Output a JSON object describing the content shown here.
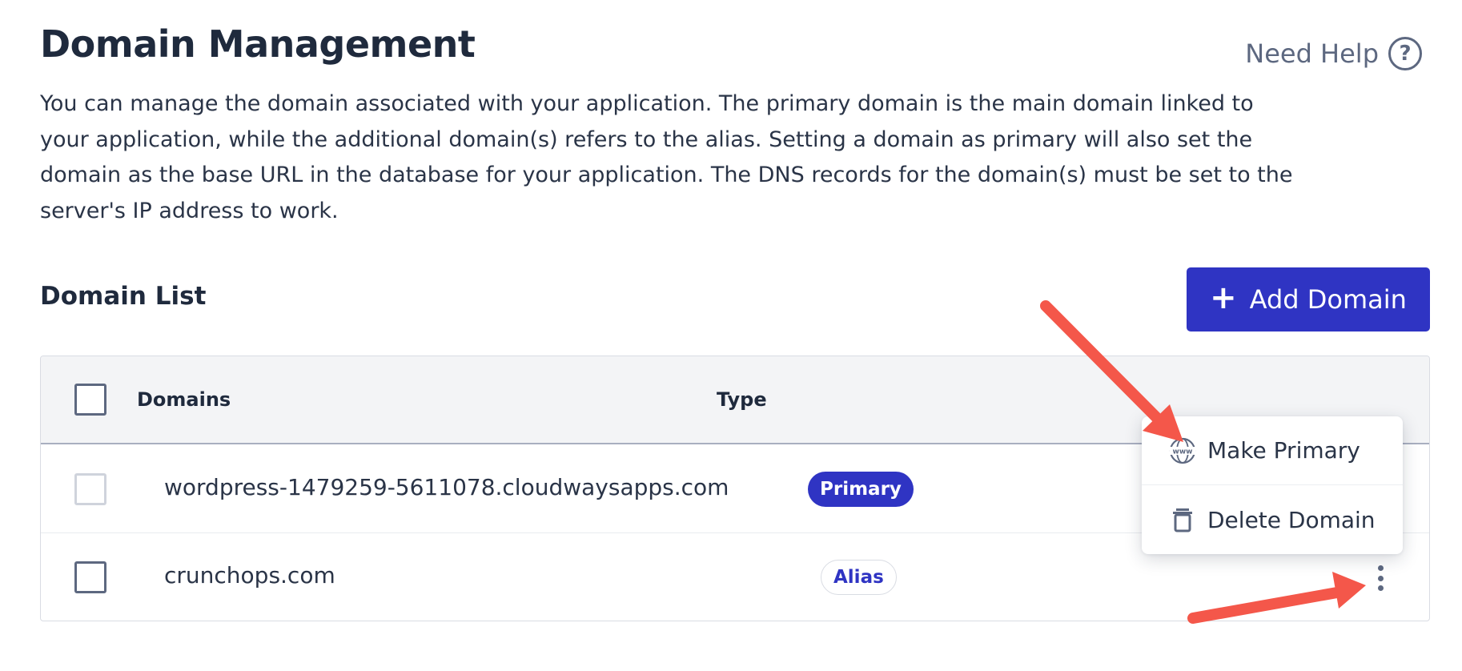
{
  "header": {
    "title": "Domain Management",
    "help_label": "Need Help",
    "description": "You can manage the domain associated with your application. The primary domain is the main domain linked to your application, while the additional domain(s) refers to the alias. Setting a domain as primary will also set the domain as the base URL in the database for your application. The DNS records for the domain(s) must be set to the server's IP address to work."
  },
  "domain_list": {
    "title": "Domain List",
    "add_button_label": "Add Domain",
    "columns": [
      "Domains",
      "Type"
    ],
    "rows": [
      {
        "domain": "wordpress-1479259-5611078.cloudwaysapps.com",
        "type": "Primary"
      },
      {
        "domain": "crunchops.com",
        "type": "Alias"
      }
    ]
  },
  "context_menu": {
    "items": [
      {
        "label": "Make Primary",
        "icon": "www-globe-icon"
      },
      {
        "label": "Delete Domain",
        "icon": "trash-icon"
      }
    ]
  },
  "colors": {
    "accent": "#2f34c3",
    "annotation_arrow": "#f4574a",
    "text": "#2a3447"
  }
}
